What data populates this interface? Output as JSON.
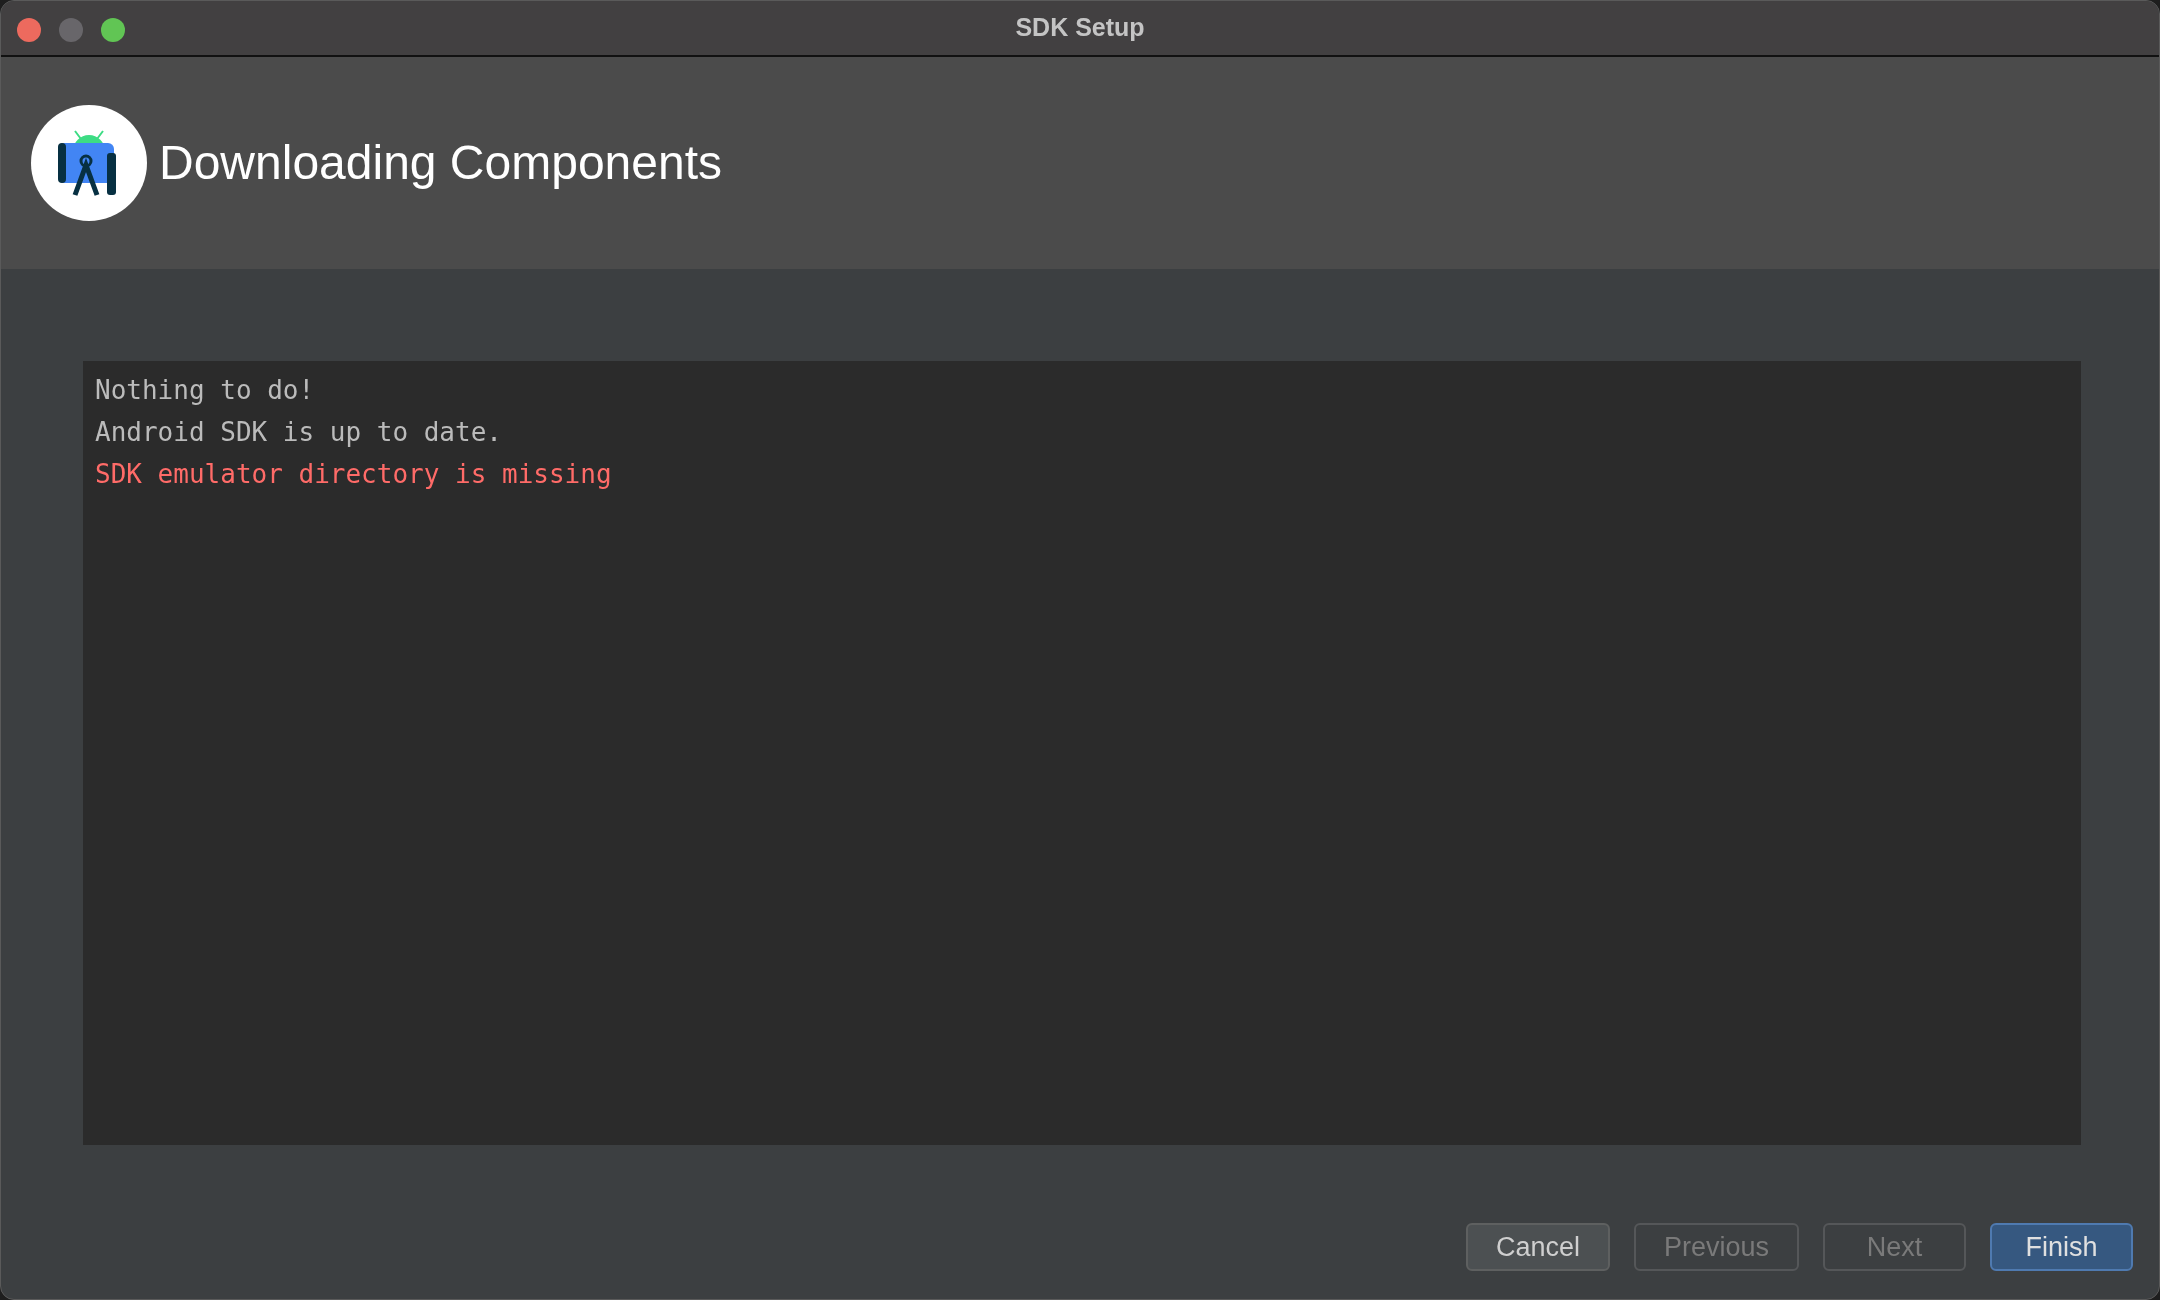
{
  "window": {
    "title": "SDK Setup"
  },
  "header": {
    "title": "Downloading Components"
  },
  "log": {
    "lines": [
      {
        "text": "Nothing to do!",
        "kind": "info"
      },
      {
        "text": "Android SDK is up to date.",
        "kind": "info"
      },
      {
        "text": "SDK emulator directory is missing",
        "kind": "error"
      }
    ]
  },
  "buttons": [
    {
      "label": "Cancel",
      "disabled": false,
      "primary": false
    },
    {
      "label": "Previous",
      "disabled": true,
      "primary": false
    },
    {
      "label": "Next",
      "disabled": true,
      "primary": false
    },
    {
      "label": "Finish",
      "disabled": false,
      "primary": true
    }
  ]
}
